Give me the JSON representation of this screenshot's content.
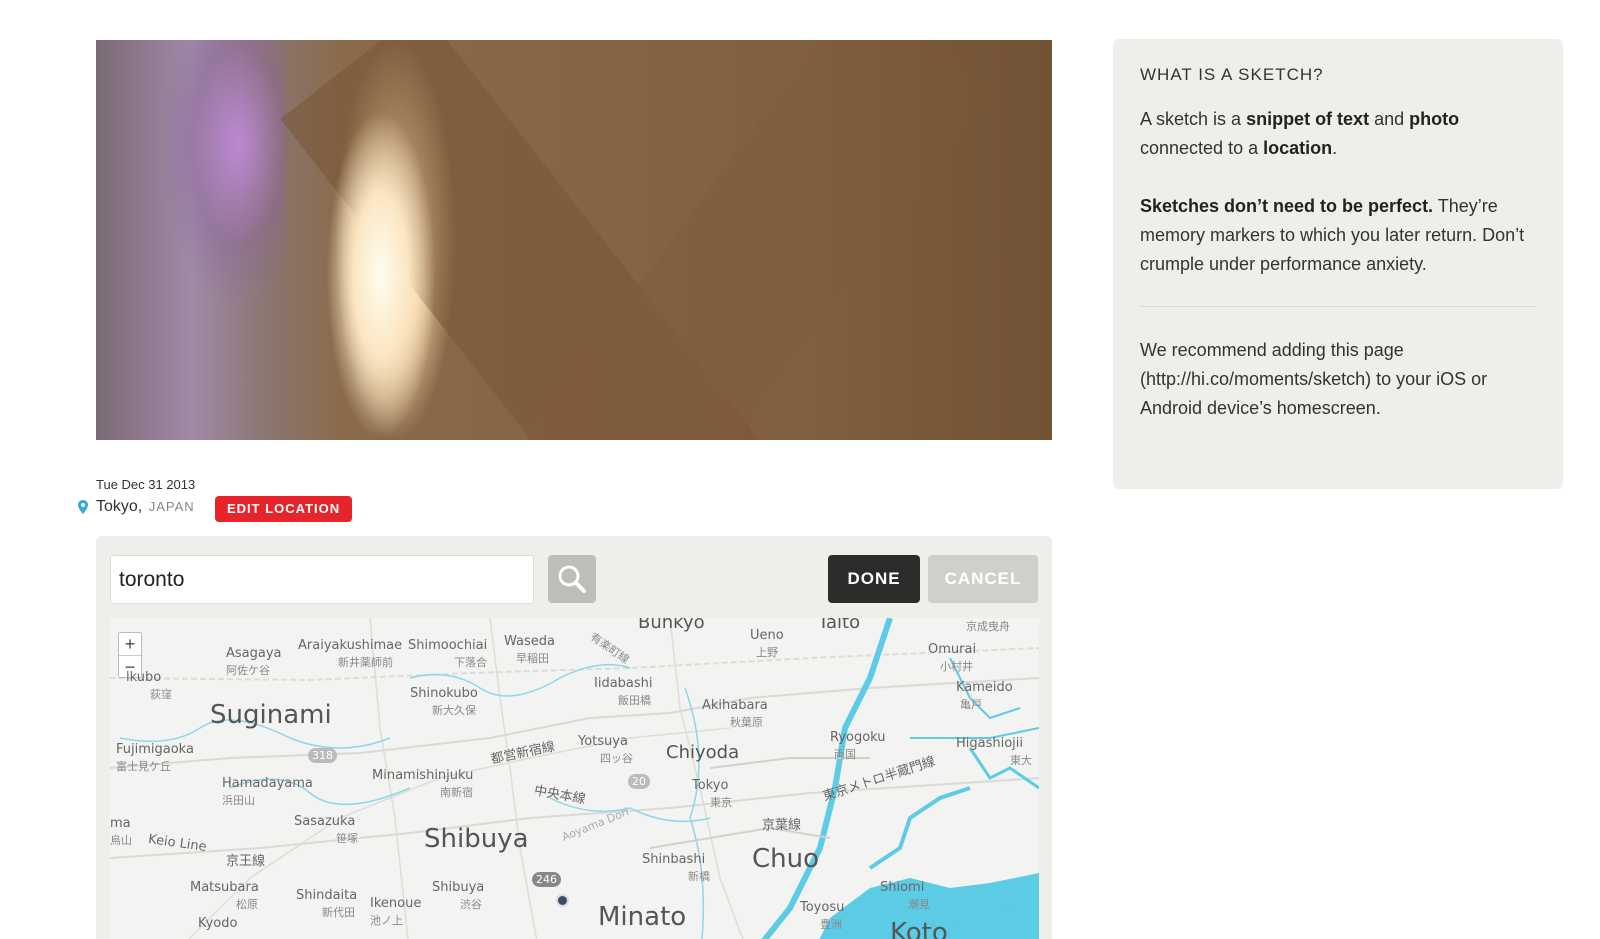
{
  "post": {
    "date": "Tue Dec 31 2013",
    "city": "Tokyo,",
    "country": "JAPAN",
    "edit_location_label": "EDIT LOCATION"
  },
  "location_editor": {
    "search_value": "toronto",
    "done_label": "DONE",
    "cancel_label": "CANCEL",
    "zoom_in": "+",
    "zoom_out": "−",
    "map_labels": {
      "bunkyo": "Bunkyo",
      "taito": "Taito",
      "ueno": "Ueno",
      "ueno_jp": "上野",
      "keisei": "京成曳舟",
      "asagaya": "Asagaya",
      "asagaya_jp": "阿佐ケ谷",
      "araiyakushimae": "Araiyakushimae",
      "araiyakushimae_jp": "新井薬師前",
      "shimoochiai": "Shimoochiai",
      "shimoochiai_jp": "下落合",
      "waseda": "Waseda",
      "waseda_jp": "早稲田",
      "yurakucho_jp": "有楽町線",
      "omurai": "Omurai",
      "omurai_jp": "小村井",
      "kubo": "lkubo",
      "kubo_jp": "荻窪",
      "shinokubo": "Shinokubo",
      "shinokubo_jp": "新大久保",
      "iidabashi": "Iidabashi",
      "iidabashi_jp": "飯田橋",
      "akihabara": "Akihabara",
      "akihabara_jp": "秋葉原",
      "kameido": "Kameido",
      "kameido_jp": "亀戸",
      "suginami": "Suginami",
      "fujimigaoka": "Fujimigaoka",
      "fujimigaoka_jp": "富士見ケ丘",
      "route318": "318",
      "toei_shinjuku_jp": "都営新宿線",
      "yotsuya": "Yotsuya",
      "yotsuya_jp": "四ッ谷",
      "chiyoda": "Chiyoda",
      "ryogoku": "Ryogoku",
      "ryogoku_jp": "両国",
      "higashiojima": "Higashiojii",
      "higashiojima_jp": "東大",
      "hamadayama": "Hamadayama",
      "hamadayama_jp": "浜田山",
      "minamishinjuku": "Minamishinjuku",
      "minamishinjuku_jp": "南新宿",
      "route20": "20",
      "tokyo": "Tokyo",
      "tokyo_jp": "東京",
      "hanzomon_jp": "東京メトロ半蔵門線",
      "chuo_line_jp": "中央本線",
      "sasazuka": "Sasazuka",
      "sasazuka_jp": "笹塚",
      "shibuya": "Shibuya",
      "aoyama": "Aoyama Dori",
      "keiyo_jp": "京葉線",
      "ma": "ma",
      "ma_jp": "烏山",
      "keio_line": "Keio Line",
      "keio_jp": "京王線",
      "route246": "246",
      "shinbashi": "Shinbashi",
      "shinbashi_jp": "新橋",
      "chuo": "Chuo",
      "matsubara": "Matsubara",
      "matsubara_jp": "松原",
      "shindaita": "Shindaita",
      "shindaita_jp": "新代田",
      "ikenoue": "Ikenoue",
      "ikenoue_jp": "池ノ上",
      "shibuya_st": "Shibuya",
      "shibuya_st_jp": "渋谷",
      "minato": "Minato",
      "toyosu": "Toyosu",
      "toyosu_jp": "豊洲",
      "shiomi": "Shiomi",
      "shiomi_jp": "潮見",
      "koto": "Koto",
      "kyodo": "Kyodo"
    }
  },
  "sidebar": {
    "heading": "WHAT IS A SKETCH?",
    "p1_a": "A sketch is a ",
    "p1_b": "snippet of text",
    "p1_c": " and ",
    "p1_d": "photo",
    "p1_e": " connected to a ",
    "p1_f": "location",
    "p1_g": ".",
    "p2_a": "Sketches don’t need to be perfect.",
    "p2_b": " They’re memory markers to which you later return. Don’t crumple under performance anxiety.",
    "p3": "We recommend adding this page (http://hi.co/moments/sketch) to your iOS or Android device’s homescreen."
  },
  "colors": {
    "accent_red": "#e8242b",
    "done_bg": "#2c2c2a",
    "panel_bg": "#eeeeea",
    "water": "#5ccbe6"
  }
}
